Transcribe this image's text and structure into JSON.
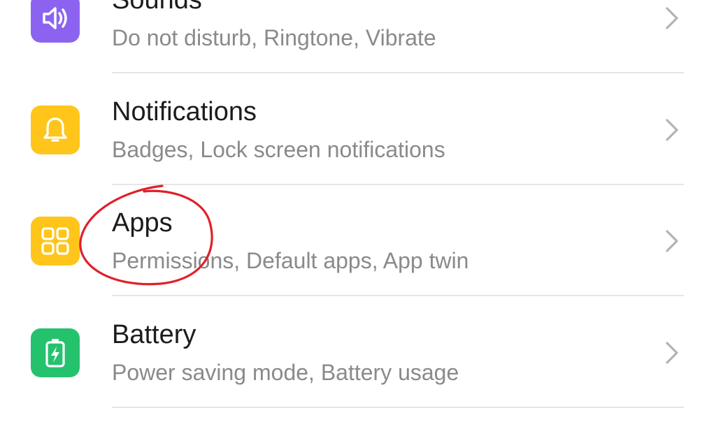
{
  "settings_list": {
    "items": [
      {
        "id": "sounds",
        "title": "Sounds",
        "subtitle": "Do not disturb, Ringtone, Vibrate",
        "icon": "speaker-icon",
        "icon_color": "#8c63f0"
      },
      {
        "id": "notifications",
        "title": "Notifications",
        "subtitle": "Badges, Lock screen notifications",
        "icon": "bell-icon",
        "icon_color": "#ffc51a"
      },
      {
        "id": "apps",
        "title": "Apps",
        "subtitle": "Permissions, Default apps, App twin",
        "icon": "apps-grid-icon",
        "icon_color": "#ffc51a"
      },
      {
        "id": "battery",
        "title": "Battery",
        "subtitle": "Power saving mode, Battery usage",
        "icon": "battery-icon",
        "icon_color": "#25c26e"
      }
    ]
  },
  "annotation": {
    "type": "hand-drawn circle",
    "target": "apps",
    "color": "#e0202a"
  },
  "colors": {
    "title_text": "#1c1c1c",
    "subtitle_text": "#8a8a8a",
    "divider": "#e6e6e6",
    "chevron": "#b3b3b3"
  }
}
